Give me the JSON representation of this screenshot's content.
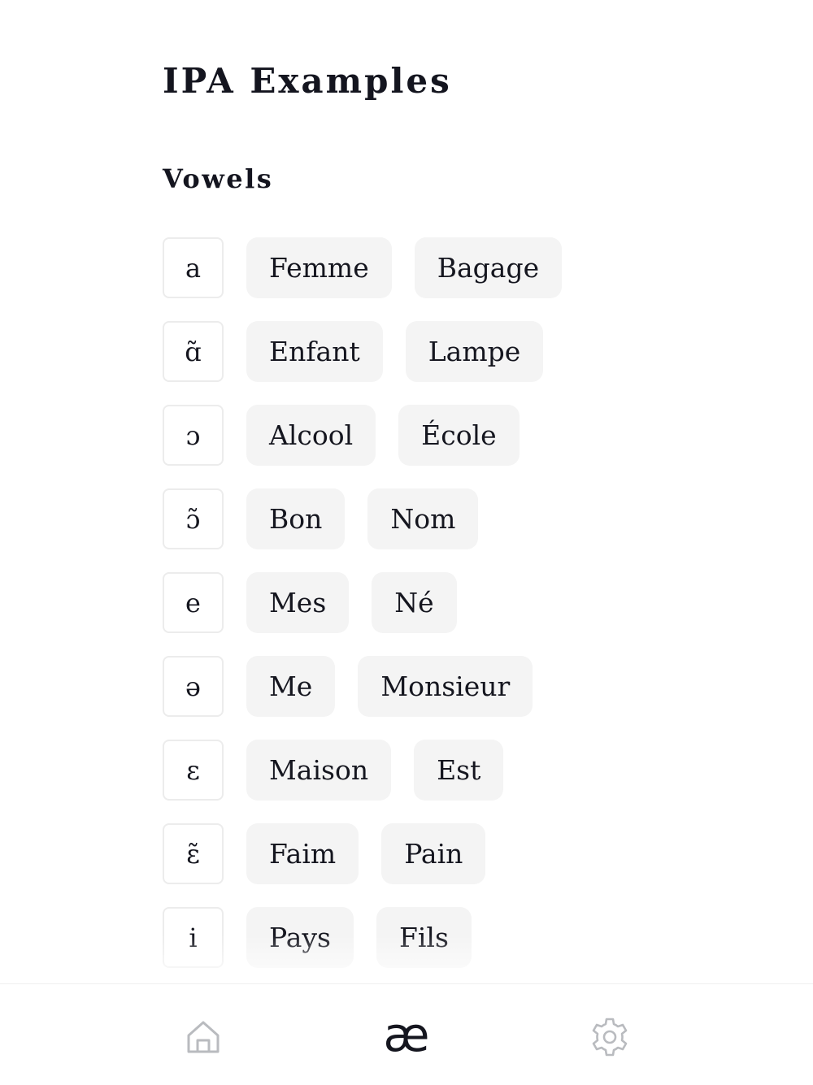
{
  "page": {
    "title": "IPA Examples",
    "section_title": "Vowels"
  },
  "vowels": [
    {
      "symbol": "a",
      "examples": [
        "Femme",
        "Bagage"
      ]
    },
    {
      "symbol": "ɑ̃",
      "examples": [
        "Enfant",
        "Lampe"
      ]
    },
    {
      "symbol": "ɔ",
      "examples": [
        "Alcool",
        "École"
      ]
    },
    {
      "symbol": "ɔ̃",
      "examples": [
        "Bon",
        "Nom"
      ]
    },
    {
      "symbol": "e",
      "examples": [
        "Mes",
        "Né"
      ]
    },
    {
      "symbol": "ə",
      "examples": [
        "Me",
        "Monsieur"
      ]
    },
    {
      "symbol": "ɛ",
      "examples": [
        "Maison",
        "Est"
      ]
    },
    {
      "symbol": "ɛ̃",
      "examples": [
        "Faim",
        "Pain"
      ]
    },
    {
      "symbol": "i",
      "examples": [
        "Pays",
        "Fils"
      ]
    }
  ],
  "tab_bar": {
    "tabs": [
      {
        "id": "home",
        "icon": "home-icon",
        "active": false
      },
      {
        "id": "ipa",
        "icon": "ae-ligature-icon",
        "glyph": "æ",
        "active": true
      },
      {
        "id": "settings",
        "icon": "gear-icon",
        "active": false
      }
    ]
  },
  "colors": {
    "text": "#15161f",
    "chip_background": "#f4f4f4",
    "box_border": "#ececec",
    "icon_inactive": "#b9bbbf",
    "icon_active": "#15161f"
  }
}
